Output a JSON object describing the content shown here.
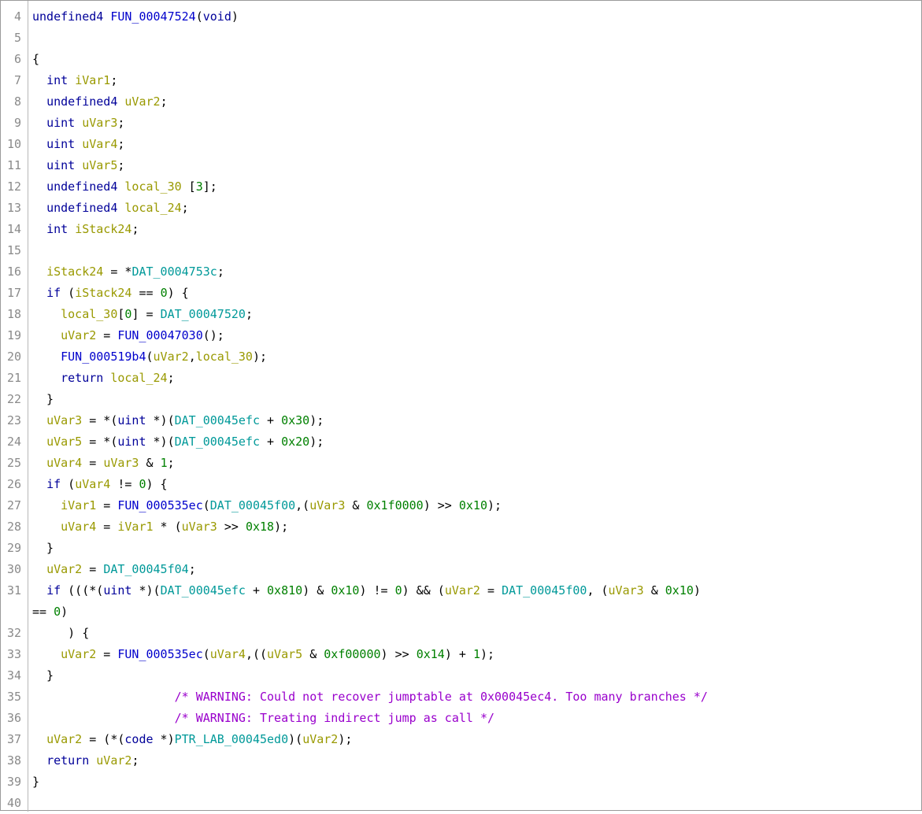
{
  "editor": {
    "colors": {
      "keyword": "#000099",
      "function": "#0000cc",
      "variable": "#999900",
      "global": "#009999",
      "number": "#008000",
      "comment": "#9900cc",
      "line_number": "#8a8a8a"
    },
    "lines": [
      {
        "n": "4",
        "segs": [
          [
            "kw",
            "undefined4"
          ],
          [
            "txt",
            " "
          ],
          [
            "fn",
            "FUN_00047524"
          ],
          [
            "txt",
            "("
          ],
          [
            "kw",
            "void"
          ],
          [
            "txt",
            ")"
          ]
        ]
      },
      {
        "n": "5",
        "segs": []
      },
      {
        "n": "6",
        "segs": [
          [
            "txt",
            "{"
          ]
        ]
      },
      {
        "n": "7",
        "segs": [
          [
            "txt",
            "  "
          ],
          [
            "kw",
            "int"
          ],
          [
            "txt",
            " "
          ],
          [
            "var",
            "iVar1"
          ],
          [
            "txt",
            ";"
          ]
        ]
      },
      {
        "n": "8",
        "segs": [
          [
            "txt",
            "  "
          ],
          [
            "kw",
            "undefined4"
          ],
          [
            "txt",
            " "
          ],
          [
            "var",
            "uVar2"
          ],
          [
            "txt",
            ";"
          ]
        ]
      },
      {
        "n": "9",
        "segs": [
          [
            "txt",
            "  "
          ],
          [
            "kw",
            "uint"
          ],
          [
            "txt",
            " "
          ],
          [
            "var",
            "uVar3"
          ],
          [
            "txt",
            ";"
          ]
        ]
      },
      {
        "n": "10",
        "segs": [
          [
            "txt",
            "  "
          ],
          [
            "kw",
            "uint"
          ],
          [
            "txt",
            " "
          ],
          [
            "var",
            "uVar4"
          ],
          [
            "txt",
            ";"
          ]
        ]
      },
      {
        "n": "11",
        "segs": [
          [
            "txt",
            "  "
          ],
          [
            "kw",
            "uint"
          ],
          [
            "txt",
            " "
          ],
          [
            "var",
            "uVar5"
          ],
          [
            "txt",
            ";"
          ]
        ]
      },
      {
        "n": "12",
        "segs": [
          [
            "txt",
            "  "
          ],
          [
            "kw",
            "undefined4"
          ],
          [
            "txt",
            " "
          ],
          [
            "var",
            "local_30"
          ],
          [
            "txt",
            " ["
          ],
          [
            "num",
            "3"
          ],
          [
            "txt",
            "];"
          ]
        ]
      },
      {
        "n": "13",
        "segs": [
          [
            "txt",
            "  "
          ],
          [
            "kw",
            "undefined4"
          ],
          [
            "txt",
            " "
          ],
          [
            "var",
            "local_24"
          ],
          [
            "txt",
            ";"
          ]
        ]
      },
      {
        "n": "14",
        "segs": [
          [
            "txt",
            "  "
          ],
          [
            "kw",
            "int"
          ],
          [
            "txt",
            " "
          ],
          [
            "var",
            "iStack24"
          ],
          [
            "txt",
            ";"
          ]
        ]
      },
      {
        "n": "15",
        "segs": []
      },
      {
        "n": "16",
        "segs": [
          [
            "txt",
            "  "
          ],
          [
            "var",
            "iStack24"
          ],
          [
            "txt",
            " = *"
          ],
          [
            "glob",
            "DAT_0004753c"
          ],
          [
            "txt",
            ";"
          ]
        ]
      },
      {
        "n": "17",
        "segs": [
          [
            "txt",
            "  "
          ],
          [
            "kw",
            "if"
          ],
          [
            "txt",
            " ("
          ],
          [
            "var",
            "iStack24"
          ],
          [
            "txt",
            " == "
          ],
          [
            "num",
            "0"
          ],
          [
            "txt",
            ") {"
          ]
        ]
      },
      {
        "n": "18",
        "segs": [
          [
            "txt",
            "    "
          ],
          [
            "var",
            "local_30"
          ],
          [
            "txt",
            "["
          ],
          [
            "num",
            "0"
          ],
          [
            "txt",
            "] = "
          ],
          [
            "glob",
            "DAT_00047520"
          ],
          [
            "txt",
            ";"
          ]
        ]
      },
      {
        "n": "19",
        "segs": [
          [
            "txt",
            "    "
          ],
          [
            "var",
            "uVar2"
          ],
          [
            "txt",
            " = "
          ],
          [
            "fn",
            "FUN_00047030"
          ],
          [
            "txt",
            "();"
          ]
        ]
      },
      {
        "n": "20",
        "segs": [
          [
            "txt",
            "    "
          ],
          [
            "fn",
            "FUN_000519b4"
          ],
          [
            "txt",
            "("
          ],
          [
            "var",
            "uVar2"
          ],
          [
            "txt",
            ","
          ],
          [
            "var",
            "local_30"
          ],
          [
            "txt",
            ");"
          ]
        ]
      },
      {
        "n": "21",
        "segs": [
          [
            "txt",
            "    "
          ],
          [
            "kw",
            "return"
          ],
          [
            "txt",
            " "
          ],
          [
            "var",
            "local_24"
          ],
          [
            "txt",
            ";"
          ]
        ]
      },
      {
        "n": "22",
        "segs": [
          [
            "txt",
            "  }"
          ]
        ]
      },
      {
        "n": "23",
        "segs": [
          [
            "txt",
            "  "
          ],
          [
            "var",
            "uVar3"
          ],
          [
            "txt",
            " = *("
          ],
          [
            "kw",
            "uint"
          ],
          [
            "txt",
            " *)("
          ],
          [
            "glob",
            "DAT_00045efc"
          ],
          [
            "txt",
            " + "
          ],
          [
            "num",
            "0x30"
          ],
          [
            "txt",
            ");"
          ]
        ]
      },
      {
        "n": "24",
        "segs": [
          [
            "txt",
            "  "
          ],
          [
            "var",
            "uVar5"
          ],
          [
            "txt",
            " = *("
          ],
          [
            "kw",
            "uint"
          ],
          [
            "txt",
            " *)("
          ],
          [
            "glob",
            "DAT_00045efc"
          ],
          [
            "txt",
            " + "
          ],
          [
            "num",
            "0x20"
          ],
          [
            "txt",
            ");"
          ]
        ]
      },
      {
        "n": "25",
        "segs": [
          [
            "txt",
            "  "
          ],
          [
            "var",
            "uVar4"
          ],
          [
            "txt",
            " = "
          ],
          [
            "var",
            "uVar3"
          ],
          [
            "txt",
            " & "
          ],
          [
            "num",
            "1"
          ],
          [
            "txt",
            ";"
          ]
        ]
      },
      {
        "n": "26",
        "segs": [
          [
            "txt",
            "  "
          ],
          [
            "kw",
            "if"
          ],
          [
            "txt",
            " ("
          ],
          [
            "var",
            "uVar4"
          ],
          [
            "txt",
            " != "
          ],
          [
            "num",
            "0"
          ],
          [
            "txt",
            ") {"
          ]
        ]
      },
      {
        "n": "27",
        "segs": [
          [
            "txt",
            "    "
          ],
          [
            "var",
            "iVar1"
          ],
          [
            "txt",
            " = "
          ],
          [
            "fn",
            "FUN_000535ec"
          ],
          [
            "txt",
            "("
          ],
          [
            "glob",
            "DAT_00045f00"
          ],
          [
            "txt",
            ",("
          ],
          [
            "var",
            "uVar3"
          ],
          [
            "txt",
            " & "
          ],
          [
            "num",
            "0x1f0000"
          ],
          [
            "txt",
            ") >> "
          ],
          [
            "num",
            "0x10"
          ],
          [
            "txt",
            ");"
          ]
        ]
      },
      {
        "n": "28",
        "segs": [
          [
            "txt",
            "    "
          ],
          [
            "var",
            "uVar4"
          ],
          [
            "txt",
            " = "
          ],
          [
            "var",
            "iVar1"
          ],
          [
            "txt",
            " * ("
          ],
          [
            "var",
            "uVar3"
          ],
          [
            "txt",
            " >> "
          ],
          [
            "num",
            "0x18"
          ],
          [
            "txt",
            ");"
          ]
        ]
      },
      {
        "n": "29",
        "segs": [
          [
            "txt",
            "  }"
          ]
        ]
      },
      {
        "n": "30",
        "segs": [
          [
            "txt",
            "  "
          ],
          [
            "var",
            "uVar2"
          ],
          [
            "txt",
            " = "
          ],
          [
            "glob",
            "DAT_00045f04"
          ],
          [
            "txt",
            ";"
          ]
        ]
      },
      {
        "n": "31",
        "segs": [
          [
            "txt",
            "  "
          ],
          [
            "kw",
            "if"
          ],
          [
            "txt",
            " (((*("
          ],
          [
            "kw",
            "uint"
          ],
          [
            "txt",
            " *)("
          ],
          [
            "glob",
            "DAT_00045efc"
          ],
          [
            "txt",
            " + "
          ],
          [
            "num",
            "0x810"
          ],
          [
            "txt",
            ") & "
          ],
          [
            "num",
            "0x10"
          ],
          [
            "txt",
            ") != "
          ],
          [
            "num",
            "0"
          ],
          [
            "txt",
            ") && ("
          ],
          [
            "var",
            "uVar2"
          ],
          [
            "txt",
            " = "
          ],
          [
            "glob",
            "DAT_00045f00"
          ],
          [
            "txt",
            ", ("
          ],
          [
            "var",
            "uVar3"
          ],
          [
            "txt",
            " & "
          ],
          [
            "num",
            "0x10"
          ],
          [
            "txt",
            ")"
          ]
        ]
      },
      {
        "n": "",
        "segs": [
          [
            "txt",
            "== "
          ],
          [
            "num",
            "0"
          ],
          [
            "txt",
            ")"
          ]
        ]
      },
      {
        "n": "32",
        "segs": [
          [
            "txt",
            "     ) {"
          ]
        ]
      },
      {
        "n": "33",
        "segs": [
          [
            "txt",
            "    "
          ],
          [
            "var",
            "uVar2"
          ],
          [
            "txt",
            " = "
          ],
          [
            "fn",
            "FUN_000535ec"
          ],
          [
            "txt",
            "("
          ],
          [
            "var",
            "uVar4"
          ],
          [
            "txt",
            ",(("
          ],
          [
            "var",
            "uVar5"
          ],
          [
            "txt",
            " & "
          ],
          [
            "num",
            "0xf00000"
          ],
          [
            "txt",
            ") >> "
          ],
          [
            "num",
            "0x14"
          ],
          [
            "txt",
            ") + "
          ],
          [
            "num",
            "1"
          ],
          [
            "txt",
            ");"
          ]
        ]
      },
      {
        "n": "34",
        "segs": [
          [
            "txt",
            "  }"
          ]
        ]
      },
      {
        "n": "35",
        "segs": [
          [
            "txt",
            "                    "
          ],
          [
            "cmt",
            "/* WARNING: Could not recover jumptable at 0x00045ec4. Too many branches */"
          ]
        ]
      },
      {
        "n": "36",
        "segs": [
          [
            "txt",
            "                    "
          ],
          [
            "cmt",
            "/* WARNING: Treating indirect jump as call */"
          ]
        ]
      },
      {
        "n": "37",
        "segs": [
          [
            "txt",
            "  "
          ],
          [
            "var",
            "uVar2"
          ],
          [
            "txt",
            " = (*("
          ],
          [
            "kw",
            "code"
          ],
          [
            "txt",
            " *)"
          ],
          [
            "glob",
            "PTR_LAB_00045ed0"
          ],
          [
            "txt",
            ")("
          ],
          [
            "var",
            "uVar2"
          ],
          [
            "txt",
            ");"
          ]
        ]
      },
      {
        "n": "38",
        "segs": [
          [
            "txt",
            "  "
          ],
          [
            "kw",
            "return"
          ],
          [
            "txt",
            " "
          ],
          [
            "var",
            "uVar2"
          ],
          [
            "txt",
            ";"
          ]
        ]
      },
      {
        "n": "39",
        "segs": [
          [
            "txt",
            "}"
          ]
        ]
      },
      {
        "n": "40",
        "segs": []
      }
    ]
  }
}
